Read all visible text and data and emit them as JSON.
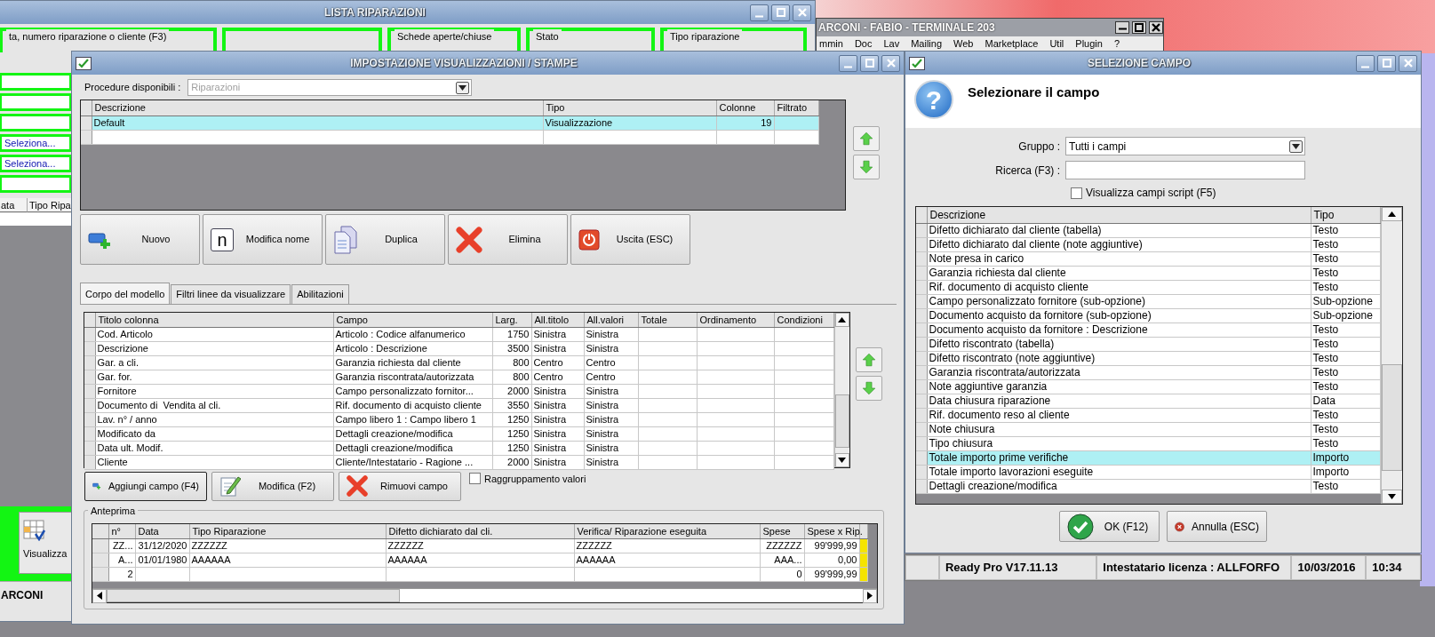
{
  "list_window": {
    "title": "LISTA RIPARAZIONI",
    "filter_groups": [
      {
        "label": "ta, numero riparazione o cliente (F3)"
      },
      {
        "label": "Schede aperte/chiuse"
      },
      {
        "label": "Stato"
      },
      {
        "label": "Tipo riparazione"
      }
    ],
    "fields": [
      {
        "kind": "blank"
      },
      {
        "kind": "blank"
      },
      {
        "kind": "blank"
      },
      {
        "kind": "select",
        "value": "Seleziona..."
      },
      {
        "kind": "select",
        "value": "Seleziona..."
      },
      {
        "kind": "blank"
      }
    ],
    "table_columns": [
      "ata",
      "Tipo Ripa"
    ],
    "toolbar_button": "Visualizza",
    "footer": "ARCONI"
  },
  "main_window": {
    "title": "ARCONI - FABIO - TERMINALE 203",
    "menu": [
      "mmin",
      "Doc",
      "Lav",
      "Mailing",
      "Web",
      "Marketplace",
      "Util",
      "Plugin",
      "?"
    ]
  },
  "settings_dialog": {
    "title": "IMPOSTAZIONE VISUALIZZAZIONI / STAMPE",
    "procedure": {
      "label": "Procedure disponibili :",
      "value": "Riparazioni",
      "disabled": true
    },
    "models": {
      "columns": [
        "Descrizione",
        "Tipo",
        "Colonne",
        "Filtrato"
      ],
      "rows": [
        {
          "descrizione": "Default",
          "tipo": "Visualizzazione",
          "colonne": "19",
          "selected": true
        }
      ]
    },
    "buttons": [
      {
        "kind": "new",
        "label": "Nuovo"
      },
      {
        "kind": "rename",
        "icon": "n",
        "label": "Modifica nome"
      },
      {
        "kind": "duplicate",
        "label": "Duplica"
      },
      {
        "kind": "delete",
        "label": "Elimina"
      },
      {
        "kind": "exit",
        "label": "Uscita (ESC)"
      }
    ],
    "tabs": [
      {
        "label": "Corpo del modello",
        "selected": true
      },
      {
        "label": "Filtri linee da visualizzare",
        "selected": false
      },
      {
        "label": "Abilitazioni",
        "selected": false
      }
    ],
    "columns_table": {
      "columns": [
        "Titolo colonna",
        "Campo",
        "Larg.",
        "All.titolo",
        "All.valori",
        "Totale",
        "Ordinamento",
        "Condizioni"
      ],
      "rows": [
        [
          "Cod. Articolo",
          "Articolo : Codice alfanumerico",
          "1750",
          "Sinistra",
          "Sinistra"
        ],
        [
          "Descrizione",
          "Articolo : Descrizione",
          "3500",
          "Sinistra",
          "Sinistra"
        ],
        [
          "Gar. a cli.",
          "Garanzia richiesta dal cliente",
          "800",
          "Centro",
          "Centro"
        ],
        [
          "Gar. for.",
          "Garanzia riscontrata/autorizzata",
          "800",
          "Centro",
          "Centro"
        ],
        [
          "Fornitore",
          "Campo personalizzato fornitor...",
          "2000",
          "Sinistra",
          "Sinistra"
        ],
        [
          "Documento di  Vendita al cli.",
          "Rif. documento di acquisto cliente",
          "3550",
          "Sinistra",
          "Sinistra"
        ],
        [
          "Lav. n° / anno",
          "Campo libero 1 : Campo libero 1",
          "1250",
          "Sinistra",
          "Sinistra"
        ],
        [
          "Modificato da",
          "Dettagli creazione/modifica",
          "1250",
          "Sinistra",
          "Sinistra"
        ],
        [
          "Data ult. Modif.",
          "Dettagli creazione/modifica",
          "1250",
          "Sinistra",
          "Sinistra"
        ],
        [
          "Cliente",
          "Cliente/Intestatario - Ragione ...",
          "2000",
          "Sinistra",
          "Sinistra"
        ]
      ]
    },
    "field_buttons": [
      {
        "kind": "add",
        "label": "Aggiungi campo (F4)"
      },
      {
        "kind": "edit",
        "label": "Modifica (F2)"
      },
      {
        "kind": "remove",
        "label": "Rimuovi campo"
      }
    ],
    "group_values": {
      "label": "Raggruppamento valori",
      "checked": false
    },
    "preview": {
      "title": "Anteprima",
      "columns": [
        "n°",
        "Data",
        "Tipo Riparazione",
        "Difetto dichiarato dal cli.",
        "Verifica/ Riparazione eseguita",
        "Spese",
        "Spese x Rip."
      ],
      "rows": [
        [
          "ZZ...",
          "31/12/2020",
          "ZZZZZZ",
          "ZZZZZZ",
          "ZZZZZZ",
          "ZZZZZZ",
          "99'999,99"
        ],
        [
          "A...",
          "01/01/1980",
          "AAAAAA",
          "AAAAAA",
          "AAAAAA",
          "AAA...",
          "0,00"
        ],
        [
          "2",
          null,
          null,
          null,
          null,
          "0",
          "99'999,99"
        ]
      ]
    }
  },
  "field_dialog": {
    "title": "SELEZIONE CAMPO",
    "heading_icon": "?",
    "heading": "Selezionare il campo",
    "group": {
      "label": "Gruppo :",
      "value": "Tutti i campi"
    },
    "search": {
      "label": "Ricerca (F3) :"
    },
    "script_fields": {
      "label": "Visualizza campi script (F5)",
      "checked": false
    },
    "columns": [
      "Descrizione",
      "Tipo"
    ],
    "rows": [
      {
        "descrizione": "Difetto dichiarato dal cliente (tabella)",
        "tipo": "Testo",
        "selected": false
      },
      {
        "descrizione": "Difetto dichiarato dal cliente (note aggiuntive)",
        "tipo": "Testo",
        "selected": false
      },
      {
        "descrizione": "Note presa in carico",
        "tipo": "Testo",
        "selected": false
      },
      {
        "descrizione": "Garanzia richiesta dal cliente",
        "tipo": "Testo",
        "selected": false
      },
      {
        "descrizione": "Rif. documento di acquisto cliente",
        "tipo": "Testo",
        "selected": false
      },
      {
        "descrizione": "Campo personalizzato fornitore (sub-opzione)",
        "tipo": "Sub-opzione",
        "selected": false
      },
      {
        "descrizione": "Documento acquisto da fornitore (sub-opzione)",
        "tipo": "Sub-opzione",
        "selected": false
      },
      {
        "descrizione": "Documento acquisto da fornitore : Descrizione",
        "tipo": "Testo",
        "selected": false
      },
      {
        "descrizione": "Difetto riscontrato (tabella)",
        "tipo": "Testo",
        "selected": false
      },
      {
        "descrizione": "Difetto riscontrato (note aggiuntive)",
        "tipo": "Testo",
        "selected": false
      },
      {
        "descrizione": "Garanzia riscontrata/autorizzata",
        "tipo": "Testo",
        "selected": false
      },
      {
        "descrizione": "Note aggiuntive garanzia",
        "tipo": "Testo",
        "selected": false
      },
      {
        "descrizione": "Data chiusura riparazione",
        "tipo": "Data",
        "selected": false
      },
      {
        "descrizione": "Rif. documento reso al cliente",
        "tipo": "Testo",
        "selected": false
      },
      {
        "descrizione": "Note chiusura",
        "tipo": "Testo",
        "selected": false
      },
      {
        "descrizione": "Tipo chiusura",
        "tipo": "Testo",
        "selected": false
      },
      {
        "descrizione": "Totale importo prime verifiche",
        "tipo": "Importo",
        "selected": true
      },
      {
        "descrizione": "Totale importo lavorazioni eseguite",
        "tipo": "Importo",
        "selected": false
      },
      {
        "descrizione": "Dettagli creazione/modifica",
        "tipo": "Testo",
        "selected": false
      }
    ],
    "buttons": [
      {
        "kind": "ok",
        "label": "OK (F12)"
      },
      {
        "kind": "cancel",
        "label": "Annulla (ESC)"
      }
    ]
  },
  "status_bar": [
    "Ready Pro V17.11.13",
    "Intestatario licenza : ALLFORFO",
    "10/03/2016",
    "10:34"
  ]
}
